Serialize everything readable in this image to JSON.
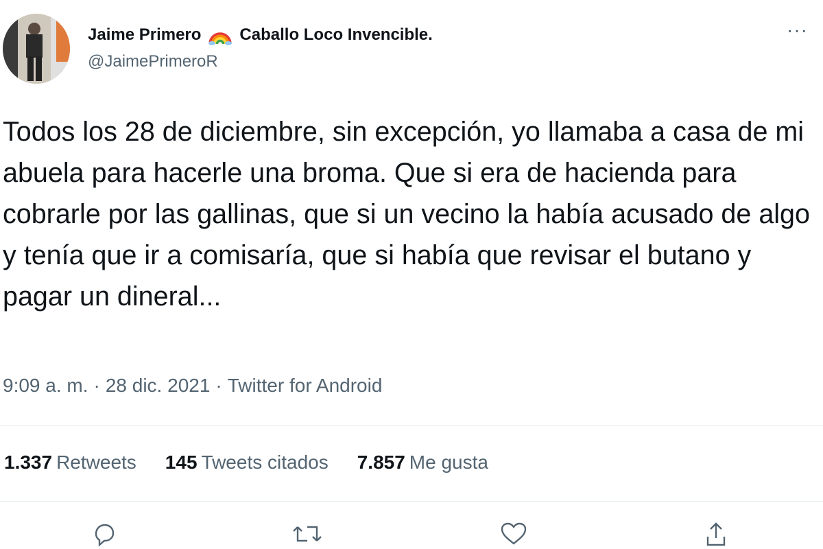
{
  "author": {
    "display_name_part1": "Jaime Primero",
    "display_name_part2": "Caballo Loco Invencible.",
    "emoji": "rainbow",
    "handle": "@JaimePrimeroR"
  },
  "more_label": "···",
  "tweet": {
    "text": "Todos los 28 de diciembre, sin excepción, yo llamaba a casa de mi abuela para hacerle una broma. Que si era de hacienda para cobrarle por las gallinas, que si un vecino la había acusado de algo y tenía que ir a comisaría, que si había que revisar el butano y pagar un dineral...",
    "time": "9:09 a. m.",
    "date": "28 dic. 2021",
    "source": "Twitter for Android",
    "separator": "·"
  },
  "stats": {
    "retweets_count": "1.337",
    "retweets_label": "Retweets",
    "quotes_count": "145",
    "quotes_label": "Tweets citados",
    "likes_count": "7.857",
    "likes_label": "Me gusta"
  },
  "actions": [
    "reply-icon",
    "retweet-icon",
    "like-icon",
    "share-icon"
  ],
  "colors": {
    "text": "#0f1419",
    "secondary": "#536471",
    "divider": "#e6ecf0"
  }
}
